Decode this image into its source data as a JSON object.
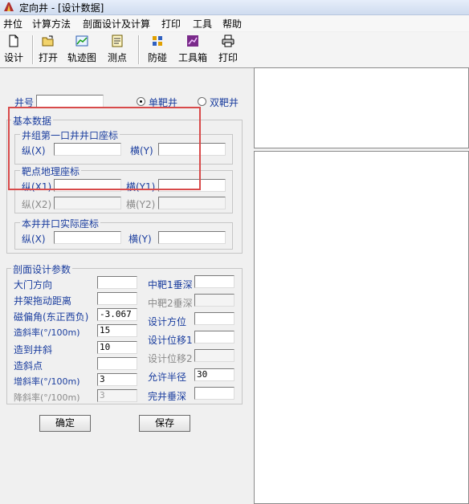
{
  "window": {
    "title": "定向井 - [设计数据]"
  },
  "menu": [
    "井位",
    "计算方法",
    "剖面设计及计算",
    "打印",
    "工具",
    "帮助"
  ],
  "toolbar": {
    "design": "设计",
    "open": "打开",
    "trajectory": "轨迹图",
    "survey": "测点",
    "collision": "防碰",
    "toolbox": "工具箱",
    "print": "打印"
  },
  "well": {
    "label": "井号",
    "value": "",
    "single_target": "单靶井",
    "double_target": "双靶井",
    "selected": "single"
  },
  "basic": {
    "title": "基本数据",
    "first_well": {
      "title": "井组第一口井井口座标",
      "north_label": "纵(X)",
      "east_label": "横(Y)",
      "north": "",
      "east": ""
    },
    "target": {
      "title": "靶点地理座标",
      "n1_label": "纵(X1)",
      "e1_label": "横(Y1)",
      "n2_label": "纵(X2)",
      "e2_label": "横(Y2)",
      "n1": "",
      "e1": "",
      "n2": "",
      "e2": ""
    },
    "actual": {
      "title": "本井井口实际座标",
      "north_label": "纵(X)",
      "east_label": "横(Y)",
      "north": "",
      "east": ""
    }
  },
  "params": {
    "title": "剖面设计参数",
    "left": [
      {
        "label": "大门方向",
        "value": "",
        "enabled": true
      },
      {
        "label": "井架拖动距离",
        "value": "",
        "enabled": true
      },
      {
        "label": "磁偏角(东正西负)",
        "value": "-3.067",
        "enabled": true
      },
      {
        "label": "造斜率(°/100m)",
        "value": "15",
        "enabled": true
      },
      {
        "label": "造到井斜",
        "value": "10",
        "enabled": true
      },
      {
        "label": "造斜点",
        "value": "",
        "enabled": true
      },
      {
        "label": "增斜率(°/100m)",
        "value": "3",
        "enabled": true
      },
      {
        "label": "降斜率(°/100m)",
        "value": "3",
        "enabled": false
      }
    ],
    "right": [
      {
        "label": "中靶1垂深",
        "value": "",
        "enabled": true
      },
      {
        "label": "中靶2垂深",
        "value": "",
        "enabled": false
      },
      {
        "label": "设计方位",
        "value": "",
        "enabled": true
      },
      {
        "label": "设计位移1",
        "value": "",
        "enabled": true
      },
      {
        "label": "设计位移2",
        "value": "",
        "enabled": false
      },
      {
        "label": "允许半径",
        "value": "30",
        "enabled": true
      },
      {
        "label": "完井垂深",
        "value": "",
        "enabled": true
      }
    ]
  },
  "buttons": {
    "ok": "确定",
    "save": "保存"
  },
  "colors": {
    "annotation_box": "#d84a4a",
    "label_blue": "#1a3d9e"
  }
}
